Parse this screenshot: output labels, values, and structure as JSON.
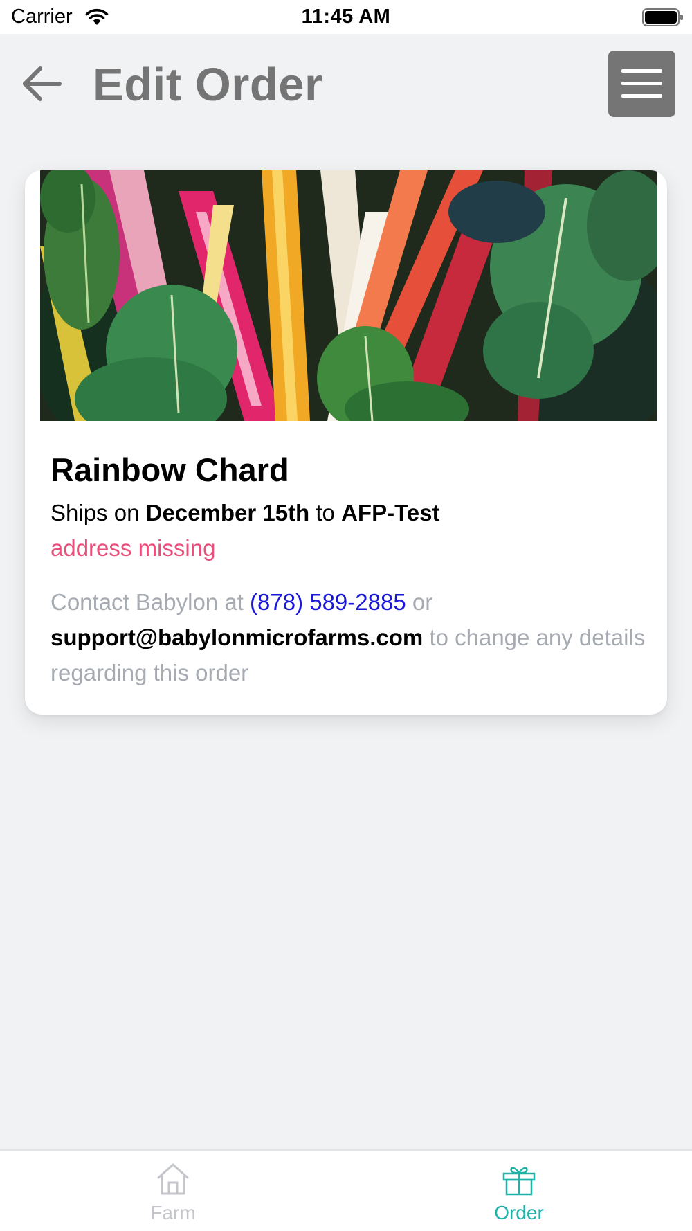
{
  "status_bar": {
    "carrier": "Carrier",
    "time": "11:45 AM",
    "wifi_icon": "wifi-icon",
    "battery_icon": "battery-icon"
  },
  "header": {
    "title": "Edit Order",
    "back_icon": "arrow-left-icon",
    "menu_icon": "hamburger-menu-icon"
  },
  "order": {
    "product_name": "Rainbow Chard",
    "ships_prefix": "Ships on",
    "ship_date": "December 15th",
    "ships_to": "to",
    "destination": "AFP-Test",
    "address_warning": "address missing",
    "contact_prefix": "Contact Babylon at",
    "phone": "(878) 589-2885",
    "contact_or": "or",
    "email": "support@babylonmicrofarms.com",
    "contact_suffix": "to change any details regarding this order"
  },
  "tabs": [
    {
      "label": "Farm",
      "icon": "house-icon",
      "active": false
    },
    {
      "label": "Order",
      "icon": "gift-box-icon",
      "active": true
    }
  ],
  "colors": {
    "background": "#f1f2f4",
    "header_gray": "#757575",
    "warning_pink": "#ea4f7c",
    "link_blue": "#1a18d6",
    "muted_text": "#a6aab1",
    "active_tab": "#1fb2a6",
    "inactive_tab": "#c4c6cb"
  }
}
